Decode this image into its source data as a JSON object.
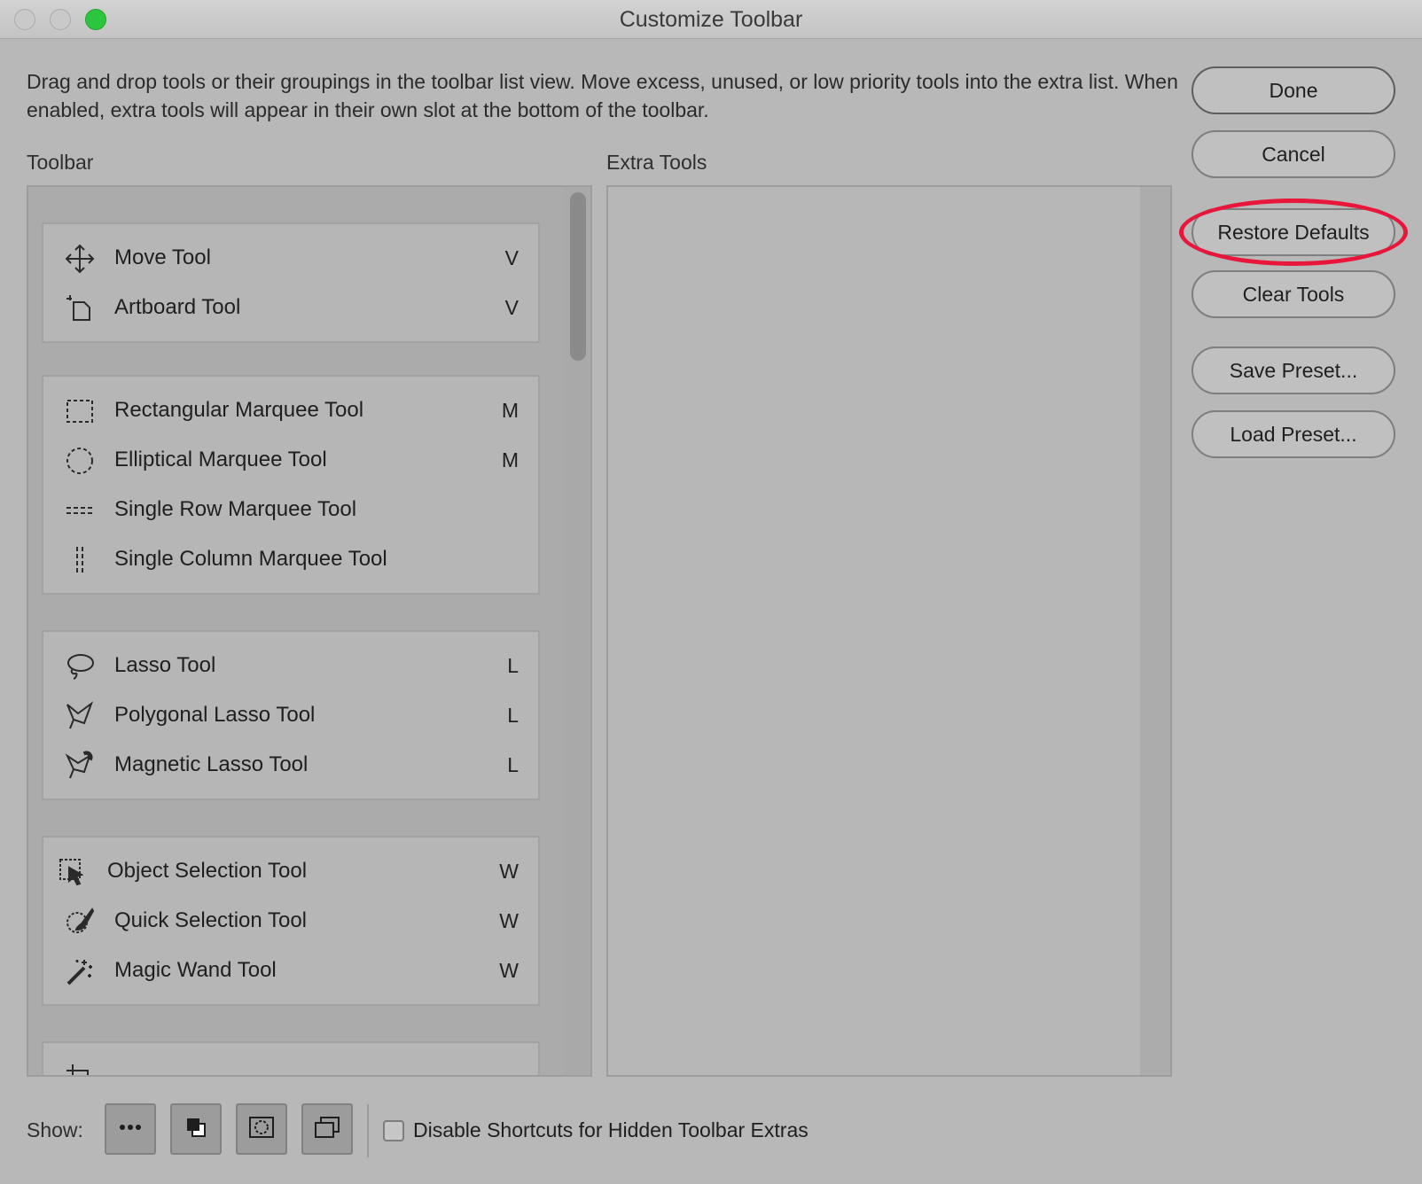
{
  "window": {
    "title": "Customize Toolbar"
  },
  "instructions": "Drag and drop tools or their groupings in the toolbar list view. Move excess, unused, or low priority tools into the extra list. When enabled, extra tools will appear in their own slot at the bottom of the toolbar.",
  "labels": {
    "toolbar": "Toolbar",
    "extra_tools": "Extra Tools"
  },
  "groups": [
    {
      "tools": [
        {
          "name": "Move Tool",
          "key": "V",
          "icon": "move-icon"
        },
        {
          "name": "Artboard Tool",
          "key": "V",
          "icon": "artboard-icon"
        }
      ]
    },
    {
      "tools": [
        {
          "name": "Rectangular Marquee Tool",
          "key": "M",
          "icon": "rect-marquee-icon"
        },
        {
          "name": "Elliptical Marquee Tool",
          "key": "M",
          "icon": "ellipse-marquee-icon"
        },
        {
          "name": "Single Row Marquee Tool",
          "key": "",
          "icon": "single-row-icon"
        },
        {
          "name": "Single Column Marquee Tool",
          "key": "",
          "icon": "single-column-icon"
        }
      ]
    },
    {
      "tools": [
        {
          "name": "Lasso Tool",
          "key": "L",
          "icon": "lasso-icon"
        },
        {
          "name": "Polygonal Lasso Tool",
          "key": "L",
          "icon": "polygonal-lasso-icon"
        },
        {
          "name": "Magnetic Lasso Tool",
          "key": "L",
          "icon": "magnetic-lasso-icon"
        }
      ]
    },
    {
      "tools": [
        {
          "name": "Object Selection Tool",
          "key": "W",
          "icon": "object-selection-icon"
        },
        {
          "name": "Quick Selection Tool",
          "key": "W",
          "icon": "quick-selection-icon"
        },
        {
          "name": "Magic Wand Tool",
          "key": "W",
          "icon": "magic-wand-icon"
        }
      ]
    }
  ],
  "buttons": {
    "done": "Done",
    "cancel": "Cancel",
    "restore_defaults": "Restore Defaults",
    "clear_tools": "Clear Tools",
    "save_preset": "Save Preset...",
    "load_preset": "Load Preset..."
  },
  "footer": {
    "show_label": "Show:",
    "checkbox_label": "Disable Shortcuts for Hidden Toolbar Extras",
    "checkbox_checked": false
  },
  "colors": {
    "highlight": "#e8163a",
    "accent_green": "#2cc53e"
  }
}
